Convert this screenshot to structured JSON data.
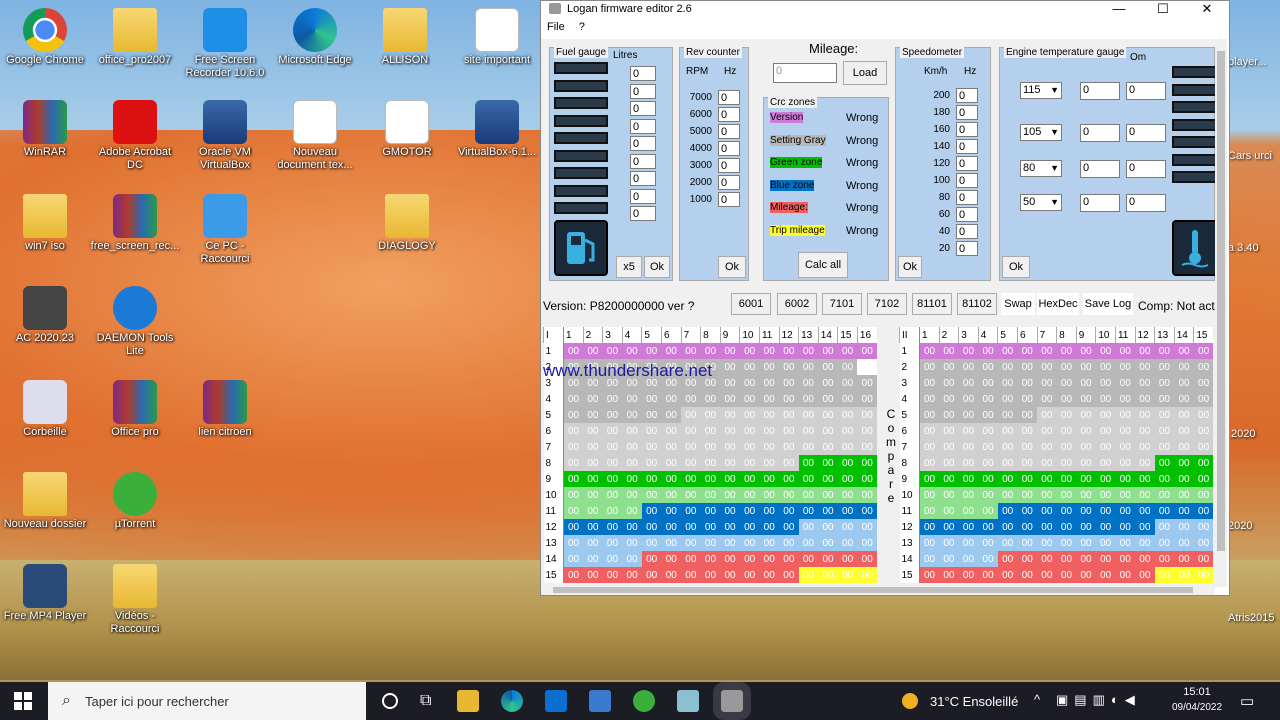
{
  "desktop": {
    "icons": [
      {
        "label": "Google Chrome",
        "icon": "chrome"
      },
      {
        "label": "office_pro2007",
        "icon": "folder"
      },
      {
        "label": "Free Screen Recorder 10.6.0",
        "icon": "recorder"
      },
      {
        "label": "Microsoft Edge",
        "icon": "edge"
      },
      {
        "label": "ALLISON",
        "icon": "folder"
      },
      {
        "label": "site important",
        "icon": "doc"
      },
      {
        "label": "WinRAR",
        "icon": "rar"
      },
      {
        "label": "Adobe Acrobat DC",
        "icon": "pdf"
      },
      {
        "label": "Oracle VM VirtualBox",
        "icon": "vbox"
      },
      {
        "label": "Nouveau document tex...",
        "icon": "doc"
      },
      {
        "label": "GMOTOR",
        "icon": "doc"
      },
      {
        "label": "VirtualBox-6.1...",
        "icon": "vbox"
      },
      {
        "label": "win7 iso",
        "icon": "folder"
      },
      {
        "label": "free_screen_rec...",
        "icon": "rar"
      },
      {
        "label": "Ce PC - Raccourci",
        "icon": "pc"
      },
      {
        "label": "DIAGLOGY",
        "icon": "folder"
      },
      {
        "label": "AC 2020.23",
        "icon": "lock"
      },
      {
        "label": "DAEMON Tools Lite",
        "icon": "daemon"
      },
      {
        "label": "Corbeille",
        "icon": "bin"
      },
      {
        "label": "Office pro",
        "icon": "rar"
      },
      {
        "label": "lien citroen",
        "icon": "rar"
      },
      {
        "label": "Nouveau dossier",
        "icon": "folder"
      },
      {
        "label": "µTorrent",
        "icon": "utorrent"
      },
      {
        "label": "Free MP4 Player",
        "icon": "mp4"
      },
      {
        "label": "Vidéos - Raccourci",
        "icon": "folder"
      }
    ],
    "right_edge_labels": [
      "player...",
      "Cars urci",
      "a 3.40",
      ".2020",
      "2020",
      "Atris2015"
    ]
  },
  "window": {
    "title": "Logan firmware editor 2.6",
    "min": "—",
    "max": "☐",
    "close": "✕",
    "menu": [
      "File",
      "?"
    ]
  },
  "fuel": {
    "label": "Fuel gauge",
    "unit": "Litres",
    "values": [
      "0",
      "0",
      "0",
      "0",
      "0",
      "0",
      "0",
      "0",
      "0"
    ],
    "x5": "x5",
    "ok": "Ok"
  },
  "rev": {
    "label": "Rev counter",
    "col1": "RPM",
    "col2": "Hz",
    "rpm": [
      "7000",
      "6000",
      "5000",
      "4000",
      "3000",
      "2000",
      "1000"
    ],
    "values": [
      "0",
      "0",
      "0",
      "0",
      "0",
      "0",
      "0"
    ],
    "ok": "Ok"
  },
  "mileage": {
    "label": "Mileage:",
    "value": "0",
    "load": "Load"
  },
  "crc": {
    "label": "Crc zones",
    "zones": [
      {
        "name": "Version",
        "status": "Wrong",
        "color": "#d07ad8"
      },
      {
        "name": "Setting Gray",
        "status": "Wrong",
        "color": "#b8b8b8"
      },
      {
        "name": "Green zone",
        "status": "Wrong",
        "color": "#00c000"
      },
      {
        "name": "Blue zone",
        "status": "Wrong",
        "color": "#0072c6"
      },
      {
        "name": "Mileage:",
        "status": "Wrong",
        "color": "#f06060"
      },
      {
        "name": "Trip mileage",
        "status": "Wrong",
        "color": "#ffff30"
      }
    ],
    "calc": "Calc all"
  },
  "speed": {
    "label": "Speedometer",
    "col1": "Km/h",
    "col2": "Hz",
    "kmh": [
      "200",
      "180",
      "160",
      "140",
      "120",
      "100",
      "80",
      "60",
      "40",
      "20"
    ],
    "values": [
      "0",
      "0",
      "0",
      "0",
      "0",
      "0",
      "0",
      "0",
      "0",
      "0"
    ],
    "ok": "Ok"
  },
  "temp": {
    "label": "Engine temperature gauge",
    "col": "Om",
    "rows": [
      {
        "sel": "115",
        "a": "0",
        "b": "0"
      },
      {
        "sel": "105",
        "a": "0",
        "b": "0"
      },
      {
        "sel": "80",
        "a": "0",
        "b": "0"
      },
      {
        "sel": "50",
        "a": "0",
        "b": "0"
      }
    ],
    "ok": "Ok"
  },
  "version_text": "Version: P8200000000 ver ?",
  "buttons": [
    "6001",
    "6002",
    "7101",
    "7102",
    "81101",
    "81102",
    "Swap",
    "HexDec",
    "Save Log"
  ],
  "comp_text": "Comp: Not act",
  "watermark": "www.thundershare.net",
  "compare_label": [
    "C",
    "o",
    "m",
    "p",
    "a",
    "r",
    "e"
  ],
  "grid_left": {
    "corner": "I",
    "cols": [
      "1",
      "2",
      "3",
      "4",
      "5",
      "6",
      "7",
      "8",
      "9",
      "10",
      "11",
      "12",
      "13",
      "14",
      "15",
      "16"
    ],
    "rows": [
      "1",
      "2",
      "3",
      "4",
      "5",
      "6",
      "7",
      "8",
      "9",
      "10",
      "11",
      "12",
      "13",
      "14",
      "15"
    ],
    "cell": "00"
  },
  "grid_right": {
    "corner": "II",
    "cols": [
      "1",
      "2",
      "3",
      "4",
      "5",
      "6",
      "7",
      "8",
      "9",
      "10",
      "11",
      "12",
      "13",
      "14",
      "15"
    ],
    "rows": [
      "1",
      "2",
      "3",
      "4",
      "5",
      "6",
      "7",
      "8",
      "9",
      "10",
      "11",
      "12",
      "13",
      "14",
      "15"
    ],
    "cell": "00"
  },
  "taskbar": {
    "search_placeholder": "Taper ici pour rechercher",
    "weather": "31°C  Ensoleillé",
    "time": "15:01",
    "date": "09/04/2022"
  }
}
